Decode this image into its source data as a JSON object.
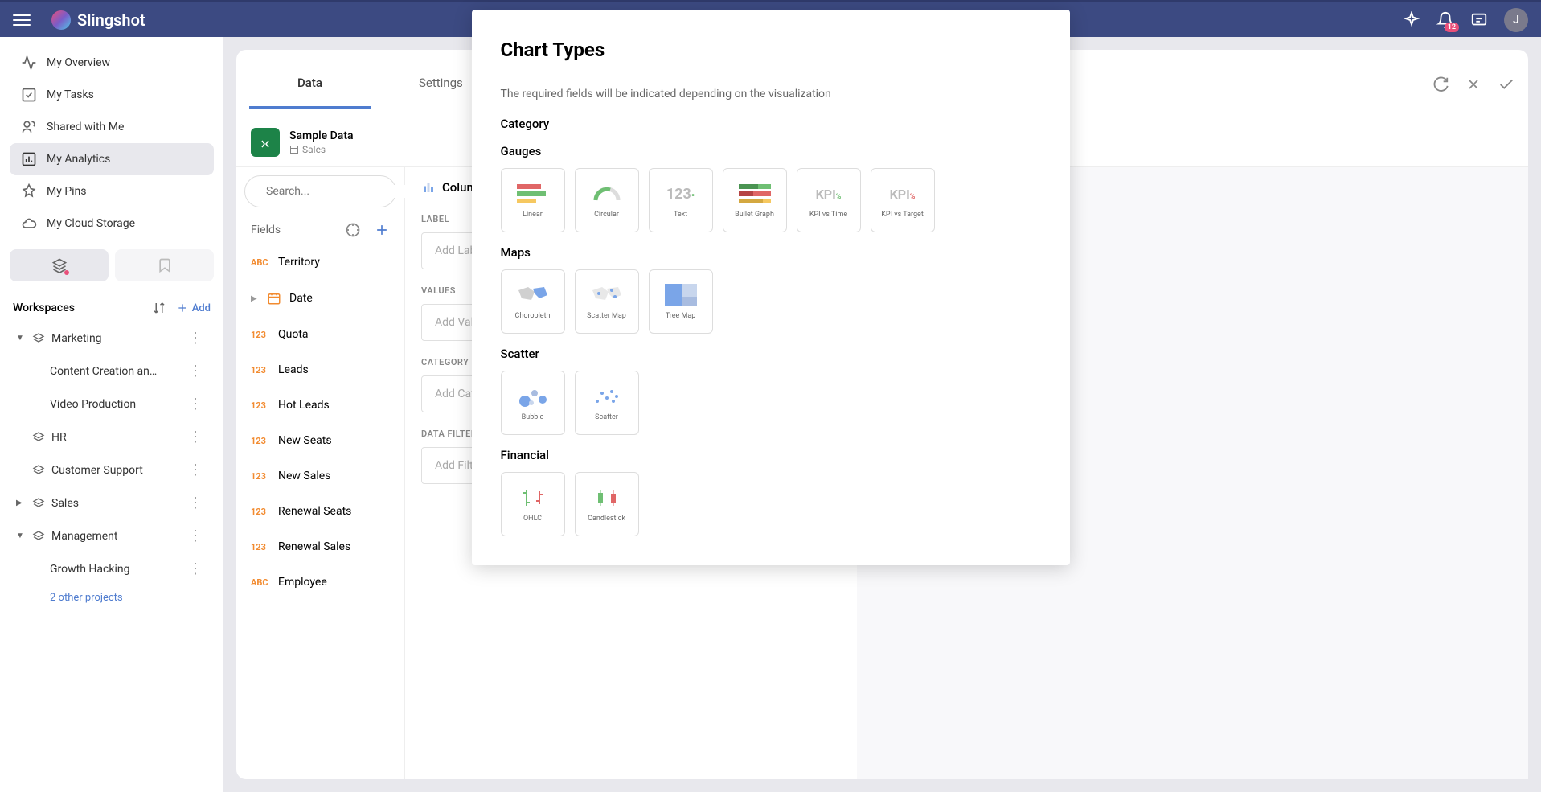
{
  "brand": "Slingshot",
  "notification_count": "12",
  "avatar_initial": "J",
  "sidebar": {
    "items": [
      {
        "label": "My Overview"
      },
      {
        "label": "My Tasks"
      },
      {
        "label": "Shared with Me"
      },
      {
        "label": "My Analytics"
      },
      {
        "label": "My Pins"
      },
      {
        "label": "My Cloud Storage"
      }
    ],
    "workspaces_label": "Workspaces",
    "add_label": "Add",
    "tree": {
      "marketing": "Marketing",
      "content_creation": "Content Creation an…",
      "video_production": "Video Production",
      "hr": "HR",
      "customer_support": "Customer Support",
      "sales": "Sales",
      "management": "Management",
      "growth_hacking": "Growth Hacking",
      "other_projects": "2 other projects"
    }
  },
  "editor": {
    "tabs": {
      "data": "Data",
      "settings": "Settings"
    },
    "datasource_name": "Sample Data",
    "datasource_sheet": "Sales",
    "search_placeholder": "Search...",
    "fields_label": "Fields",
    "chart_type": "Column",
    "fields": [
      {
        "type": "abc",
        "type_label": "ABC",
        "name": "Territory"
      },
      {
        "type": "date",
        "type_label": "",
        "name": "Date",
        "expandable": true
      },
      {
        "type": "num",
        "type_label": "123",
        "name": "Quota"
      },
      {
        "type": "num",
        "type_label": "123",
        "name": "Leads"
      },
      {
        "type": "num",
        "type_label": "123",
        "name": "Hot Leads"
      },
      {
        "type": "num",
        "type_label": "123",
        "name": "New Seats"
      },
      {
        "type": "num",
        "type_label": "123",
        "name": "New Sales"
      },
      {
        "type": "num",
        "type_label": "123",
        "name": "Renewal Seats"
      },
      {
        "type": "num",
        "type_label": "123",
        "name": "Renewal Sales"
      },
      {
        "type": "abc",
        "type_label": "ABC",
        "name": "Employee"
      }
    ],
    "sections": {
      "label": {
        "header": "LABEL",
        "placeholder": "Add Label"
      },
      "values": {
        "header": "VALUES",
        "placeholder": "Add Values"
      },
      "category": {
        "header": "CATEGORY",
        "placeholder": "Add Category"
      },
      "filters": {
        "header": "DATA FILTERS",
        "placeholder": "Add Filter"
      }
    }
  },
  "modal": {
    "title": "Chart Types",
    "subtitle": "The required fields will be indicated depending on the visualization",
    "sections": {
      "category": "Category",
      "gauges": "Gauges",
      "maps": "Maps",
      "scatter": "Scatter",
      "financial": "Financial"
    },
    "gauges": [
      {
        "label": "Linear"
      },
      {
        "label": "Circular"
      },
      {
        "label": "Text"
      },
      {
        "label": "Bullet Graph"
      },
      {
        "label": "KPI vs Time"
      },
      {
        "label": "KPI vs Target"
      }
    ],
    "maps": [
      {
        "label": "Choropleth"
      },
      {
        "label": "Scatter Map"
      },
      {
        "label": "Tree Map"
      }
    ],
    "scatter": [
      {
        "label": "Bubble"
      },
      {
        "label": "Scatter"
      }
    ],
    "financial": [
      {
        "label": "OHLC"
      },
      {
        "label": "Candlestick"
      }
    ]
  }
}
